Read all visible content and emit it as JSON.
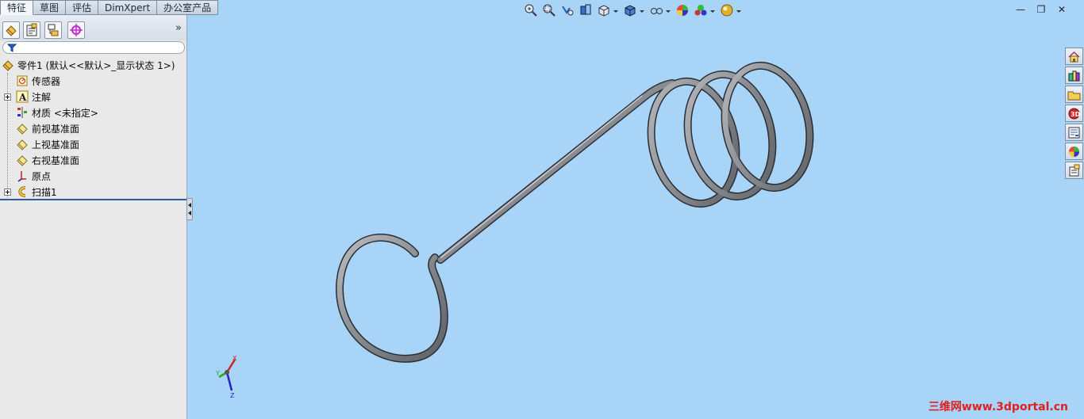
{
  "command_manager": {
    "tabs": [
      {
        "label": "特征",
        "active": true
      },
      {
        "label": "草图",
        "active": false
      },
      {
        "label": "评估",
        "active": false
      },
      {
        "label": "DimXpert",
        "active": false
      },
      {
        "label": "办公室产品",
        "active": false
      }
    ]
  },
  "property_manager": {
    "panel_icons": [
      "feature-manager-icon",
      "property-manager-icon",
      "configuration-manager-icon",
      "dimxpert-manager-icon"
    ],
    "more_label": "»"
  },
  "feature_tree": {
    "root": {
      "label": "零件1  (默认<<默认>_显示状态 1>)",
      "icon": "part-icon"
    },
    "items": [
      {
        "label": "传感器",
        "icon": "sensor-icon",
        "expandable": false
      },
      {
        "label": "注解",
        "icon": "annotation-icon",
        "expandable": true
      },
      {
        "label": "材质 <未指定>",
        "icon": "material-icon",
        "expandable": false
      },
      {
        "label": "前视基准面",
        "icon": "plane-icon",
        "expandable": false
      },
      {
        "label": "上视基准面",
        "icon": "plane-icon",
        "expandable": false
      },
      {
        "label": "右视基准面",
        "icon": "plane-icon",
        "expandable": false
      },
      {
        "label": "原点",
        "icon": "origin-icon",
        "expandable": false
      },
      {
        "label": "扫描1",
        "icon": "sweep-icon",
        "expandable": true
      }
    ]
  },
  "heads_up_toolbar": [
    "zoom-to-fit-icon",
    "zoom-to-area-icon",
    "previous-view-icon",
    "section-view-icon",
    "view-orientation-icon",
    "display-style-icon",
    "hide-show-items-icon",
    "edit-appearance-icon",
    "apply-scene-icon",
    "view-settings-icon"
  ],
  "window_controls": {
    "minimize": "—",
    "restore": "❐",
    "close": "✕"
  },
  "task_pane": [
    "home-icon",
    "design-library-icon",
    "file-explorer-icon",
    "view-palette-icon",
    "appearances-icon",
    "custom-properties-icon",
    "solidworks-resources-icon"
  ],
  "triad": {
    "x": "X",
    "y": "Y",
    "z": "Z"
  },
  "watermark": "三维网www.3dportal.cn",
  "colors": {
    "viewport_background": "#a8d4f8",
    "model_tube": "#8a8d92",
    "model_outline": "#2b2d31",
    "rollback_bar": "#2f5aa0"
  }
}
